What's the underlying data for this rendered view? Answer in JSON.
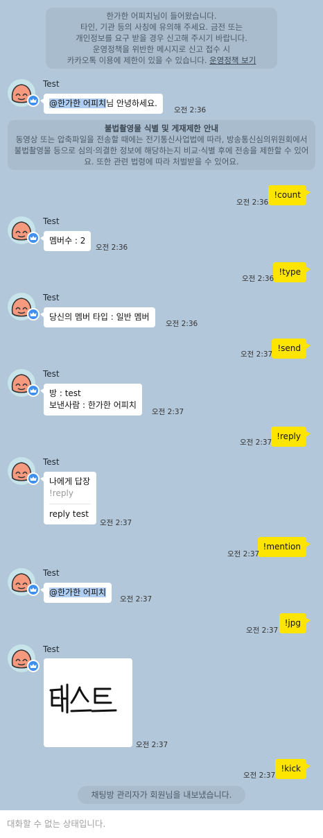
{
  "notices": {
    "join": {
      "line1": "한가한 어피치님이 들어왔습니다.",
      "line2": "타인, 기관 등의 사칭에 유의해 주세요. 금전 또는",
      "line3": "개인정보를 요구 받을 경우 신고해 주시기 바랍니다.",
      "line4": "운영정책을 위반한 메시지로 신고 접수 시",
      "line5_text": "카카오톡 이용에 제한이 있을 수 있습니다.",
      "line5_link": "운영정책 보기"
    },
    "law": {
      "title": "불법촬영물 식별 및 게재제한 안내",
      "body": "동영상 또는 압축파일을 전송할 때에는 전기통신사업법에 따라, 방송통신심의위원회에서 불법촬영물 등으로 심의·의결한 정보에 해당하는지 비교·식별 후에 전송을 제한할 수 있어요. 또한 관련 법령에 따라 처벌받을 수 있어요."
    },
    "kick": "채팅방 관리자가 회원님을 내보냈습니다."
  },
  "sender_name": "Test",
  "messages": {
    "m1": {
      "mention": "@한가한 어피치",
      "rest": "님 안녕하세요.",
      "time": "오전 2:36"
    },
    "c1": {
      "text": "!count",
      "time": "오전 2:36"
    },
    "m2": {
      "text": "멤버수 : 2",
      "time": "오전 2:36"
    },
    "c2": {
      "text": "!type",
      "time": "오전 2:36"
    },
    "m3": {
      "text": "당신의 멤버 타입 : 일반 멤버",
      "time": "오전 2:36"
    },
    "c3": {
      "text": "!send",
      "time": "오전 2:37"
    },
    "m4": {
      "line1": "방 : test",
      "line2": "보낸사람 : 한가한 어피치",
      "time": "오전 2:37"
    },
    "c4": {
      "text": "!reply",
      "time": "오전 2:37"
    },
    "m5": {
      "title": "나에게 답장",
      "quote": "!reply",
      "reply": "reply test",
      "time": "오전 2:37"
    },
    "c5": {
      "text": "!mention",
      "time": "오전 2:37"
    },
    "m6": {
      "mention": "@한가한 어피치",
      "time": "오전 2:37"
    },
    "c6": {
      "text": "!jpg",
      "time": "오전 2:37"
    },
    "m7": {
      "image_text": "테스트",
      "time": "오전 2:37"
    },
    "c7": {
      "text": "!kick",
      "time": "오전 2:37"
    }
  },
  "footer": {
    "status": "대화할 수 없는 상태입니다."
  },
  "colors": {
    "background": "#b2c7d9",
    "my_bubble": "#fee500",
    "mention_highlight": "#aecdf1",
    "badge": "#3e8ff1"
  },
  "icons": {
    "avatar": "apeach-avatar-icon",
    "badge": "crown-badge-icon"
  }
}
